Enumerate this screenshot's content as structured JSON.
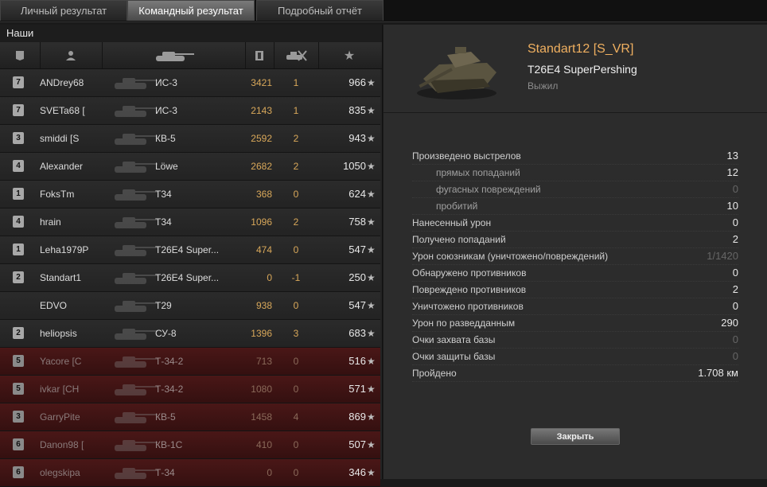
{
  "tabs": [
    "Личный результат",
    "Командный результат",
    "Подробный отчёт"
  ],
  "active_tab": 1,
  "team": {
    "title": "Наши",
    "header_icons": [
      "rank-icon",
      "player-icon",
      "tank-icon",
      "damage-icon",
      "kills-icon",
      "xp-star-icon"
    ],
    "rows": [
      {
        "rank": "7",
        "player": "ANDrey68",
        "tank": "ИС-3",
        "damage": "3421",
        "kills": "1",
        "xp": "966",
        "alive": true
      },
      {
        "rank": "7",
        "player": "SVETa68 [",
        "tank": "ИС-3",
        "damage": "2143",
        "kills": "1",
        "xp": "835",
        "alive": true
      },
      {
        "rank": "3",
        "player": "smiddi [S",
        "tank": "КВ-5",
        "damage": "2592",
        "kills": "2",
        "xp": "943",
        "alive": true
      },
      {
        "rank": "4",
        "player": "Alexander",
        "tank": "Löwe",
        "damage": "2682",
        "kills": "2",
        "xp": "1050",
        "alive": true
      },
      {
        "rank": "1",
        "player": "FoksTm",
        "tank": "T34",
        "damage": "368",
        "kills": "0",
        "xp": "624",
        "alive": true
      },
      {
        "rank": "4",
        "player": "hrain",
        "tank": "T34",
        "damage": "1096",
        "kills": "2",
        "xp": "758",
        "alive": true
      },
      {
        "rank": "1",
        "player": "Leha1979P",
        "tank": "T26E4 Super...",
        "damage": "474",
        "kills": "0",
        "xp": "547",
        "alive": true
      },
      {
        "rank": "2",
        "player": "Standart1",
        "tank": "T26E4 Super...",
        "damage": "0",
        "kills": "-1",
        "xp": "250",
        "alive": true
      },
      {
        "rank": "",
        "player": "EDVO",
        "tank": "T29",
        "damage": "938",
        "kills": "0",
        "xp": "547",
        "alive": true
      },
      {
        "rank": "2",
        "player": "heliopsis",
        "tank": "СУ-8",
        "damage": "1396",
        "kills": "3",
        "xp": "683",
        "alive": true
      },
      {
        "rank": "5",
        "player": "Yacore [C",
        "tank": "Т-34-2",
        "damage": "713",
        "kills": "0",
        "xp": "516",
        "alive": false
      },
      {
        "rank": "5",
        "player": "ivkar [CH",
        "tank": "Т-34-2",
        "damage": "1080",
        "kills": "0",
        "xp": "571",
        "alive": false
      },
      {
        "rank": "3",
        "player": "GarryPite",
        "tank": "КВ-5",
        "damage": "1458",
        "kills": "4",
        "xp": "869",
        "alive": false
      },
      {
        "rank": "6",
        "player": "Danon98 [",
        "tank": "КВ-1С",
        "damage": "410",
        "kills": "0",
        "xp": "507",
        "alive": false
      },
      {
        "rank": "6",
        "player": "olegskipa",
        "tank": "Т-34",
        "damage": "0",
        "kills": "0",
        "xp": "346",
        "alive": false
      }
    ]
  },
  "detail": {
    "player_name": "Standart12 [S_VR]",
    "tank_name": "T26E4 SuperPershing",
    "status": "Выжил",
    "stats": [
      {
        "label": "Произведено выстрелов",
        "value": "13",
        "sub": false,
        "dim": false
      },
      {
        "label": "прямых попаданий",
        "value": "12",
        "sub": true,
        "dim": false
      },
      {
        "label": "фугасных повреждений",
        "value": "0",
        "sub": true,
        "dim": true
      },
      {
        "label": "пробитий",
        "value": "10",
        "sub": true,
        "dim": false
      },
      {
        "label": "Нанесенный урон",
        "value": "0",
        "sub": false,
        "dim": false
      },
      {
        "label": "Получено попаданий",
        "value": "2",
        "sub": false,
        "dim": false
      },
      {
        "label": "Урон союзникам (уничтожено/повреждений)",
        "value": "1/1420",
        "sub": false,
        "dim": true
      },
      {
        "label": "Обнаружено противников",
        "value": "0",
        "sub": false,
        "dim": false
      },
      {
        "label": "Повреждено противников",
        "value": "2",
        "sub": false,
        "dim": false
      },
      {
        "label": "Уничтожено противников",
        "value": "0",
        "sub": false,
        "dim": false
      },
      {
        "label": "Урон по разведданным",
        "value": "290",
        "sub": false,
        "dim": false
      },
      {
        "label": "Очки захвата базы",
        "value": "0",
        "sub": false,
        "dim": true
      },
      {
        "label": "Очки защиты базы",
        "value": "0",
        "sub": false,
        "dim": true
      },
      {
        "label": "Пройдено",
        "value": "1.708 км",
        "sub": false,
        "dim": false
      }
    ],
    "close_label": "Закрыть"
  },
  "colors": {
    "accent_name": "#f0b060",
    "damage": "#d9a85a",
    "dead_row": "#4a1717"
  }
}
